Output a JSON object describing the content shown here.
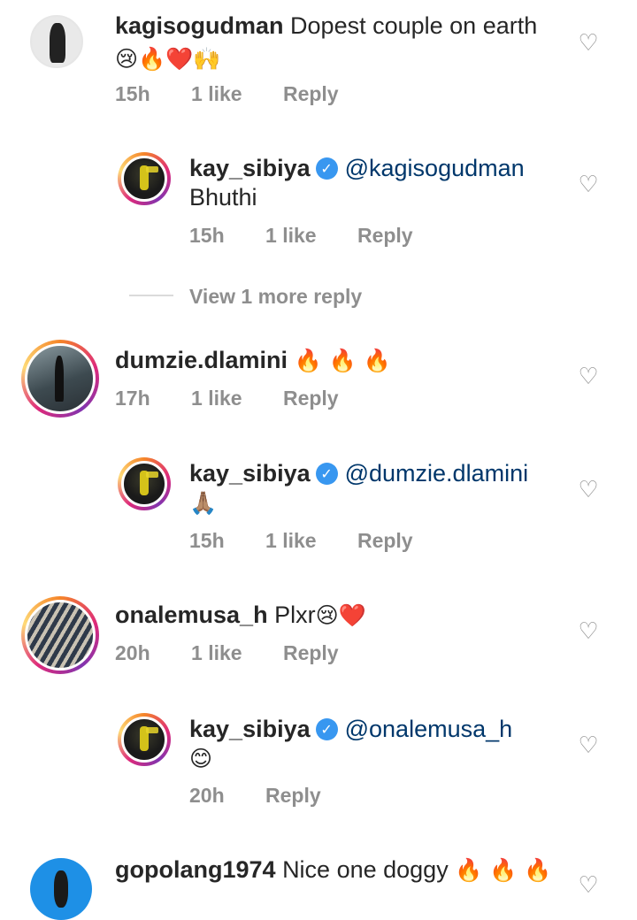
{
  "comments": [
    {
      "username": "kagisogudman",
      "text": "Dopest couple on earth",
      "emojis": "😢🔥❤️🙌",
      "time": "15h",
      "likes": "1 like",
      "reply": "Reply",
      "replies": [
        {
          "username": "kay_sibiya",
          "verified": true,
          "mention": "@kagisogudman",
          "text": "Bhuthi",
          "time": "15h",
          "likes": "1 like",
          "reply": "Reply"
        }
      ],
      "view_more": "View 1 more reply"
    },
    {
      "username": "dumzie.dlamini",
      "text": "",
      "emojis": "🔥 🔥 🔥",
      "time": "17h",
      "likes": "1 like",
      "reply": "Reply",
      "replies": [
        {
          "username": "kay_sibiya",
          "verified": true,
          "mention": "@dumzie.dlamini",
          "emojis": "🙏🏽",
          "time": "15h",
          "likes": "1 like",
          "reply": "Reply"
        }
      ]
    },
    {
      "username": "onalemusa_h",
      "text": "Plxr",
      "emojis": "😢❤️",
      "time": "20h",
      "likes": "1 like",
      "reply": "Reply",
      "replies": [
        {
          "username": "kay_sibiya",
          "verified": true,
          "mention": "@onalemusa_h",
          "emojis": "😊",
          "time": "20h",
          "reply": "Reply"
        }
      ]
    },
    {
      "username": "gopolang1974",
      "text": "Nice one doggy",
      "emojis": "🔥 🔥 🔥"
    }
  ],
  "icons": {
    "heart": "heart-outline-icon",
    "verified": "verified-badge-icon"
  },
  "colors": {
    "meta": "#8e8e8e",
    "mention": "#00376b",
    "verified": "#3897f0"
  }
}
